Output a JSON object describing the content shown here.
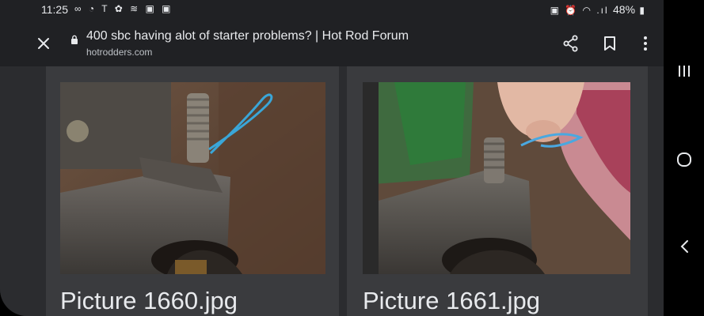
{
  "status_bar": {
    "time": "11:25",
    "left_icons": "∞ ◔ T ✿ ≋ ▣ ▣",
    "right_icons": "▣ ⏰ ◠ .ıl",
    "battery": "48%"
  },
  "toolbar": {
    "title": "400 sbc having alot of starter problems? | Hot Rod Forum",
    "domain": "hotrodders.com"
  },
  "attachments": [
    {
      "caption": "Picture 1660.jpg"
    },
    {
      "caption": "Picture 1661.jpg"
    }
  ],
  "colors": {
    "background": "#202124",
    "content_bg": "#2b2c2f",
    "card_bg": "#3a3b3e",
    "text": "#e8eaed"
  }
}
